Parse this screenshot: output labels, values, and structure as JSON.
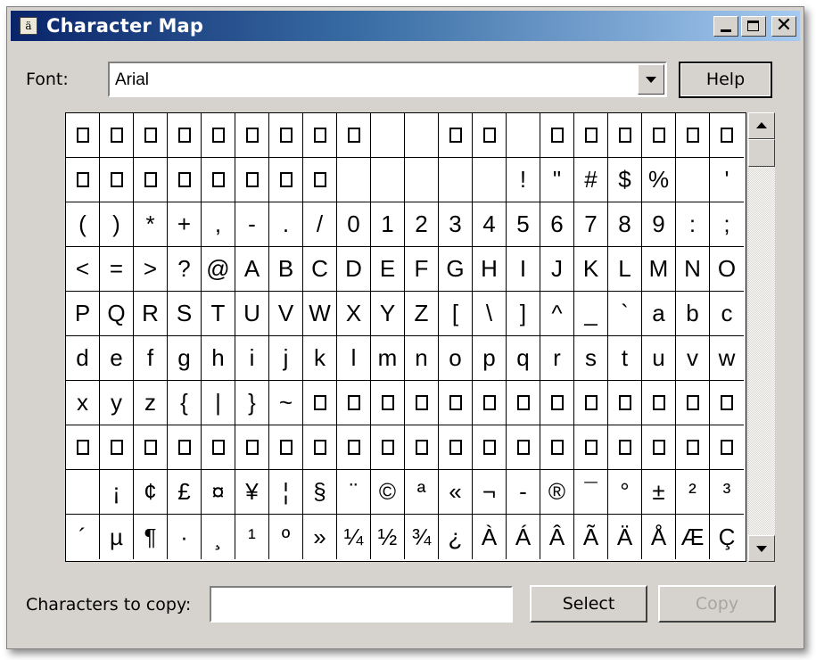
{
  "window": {
    "title": "Character Map",
    "icon": "character-map-app-icon",
    "icon_glyph": "ä"
  },
  "title_buttons": {
    "minimize": "minimize-icon",
    "maximize": "maximize-icon",
    "close": "close-icon",
    "close_glyph": "✕"
  },
  "font_label": "Font:",
  "font_value": "Arial",
  "help_label": "Help",
  "chars_label": "Characters to copy:",
  "chars_value": "",
  "select_label": "Select",
  "copy_label": "Copy",
  "char_grid": [
    [
      "□",
      "□",
      "□",
      "□",
      "□",
      "□",
      "□",
      "□",
      "□",
      "",
      "",
      "□",
      "□",
      "",
      "□",
      "□",
      "□",
      "□",
      "□",
      "□"
    ],
    [
      "□",
      "□",
      "□",
      "□",
      "□",
      "□",
      "□",
      "□",
      "",
      "",
      "",
      "",
      "",
      "!",
      "\"",
      "#",
      "$",
      "%",
      "",
      "'"
    ],
    [
      "(",
      ")",
      "*",
      "+",
      ",",
      "-",
      ".",
      "/",
      "0",
      "1",
      "2",
      "3",
      "4",
      "5",
      "6",
      "7",
      "8",
      "9",
      ":",
      ";"
    ],
    [
      "<",
      "=",
      ">",
      "?",
      "@",
      "A",
      "B",
      "C",
      "D",
      "E",
      "F",
      "G",
      "H",
      "I",
      "J",
      "K",
      "L",
      "M",
      "N",
      "O"
    ],
    [
      "P",
      "Q",
      "R",
      "S",
      "T",
      "U",
      "V",
      "W",
      "X",
      "Y",
      "Z",
      "[",
      "\\",
      "]",
      "^",
      "_",
      "`",
      "a",
      "b",
      "c"
    ],
    [
      "d",
      "e",
      "f",
      "g",
      "h",
      "i",
      "j",
      "k",
      "l",
      "m",
      "n",
      "o",
      "p",
      "q",
      "r",
      "s",
      "t",
      "u",
      "v",
      "w"
    ],
    [
      "x",
      "y",
      "z",
      "{",
      "|",
      "}",
      "~",
      "□",
      "□",
      "□",
      "□",
      "□",
      "□",
      "□",
      "□",
      "□",
      "□",
      "□",
      "□",
      "□"
    ],
    [
      "□",
      "□",
      "□",
      "□",
      "□",
      "□",
      "□",
      "□",
      "□",
      "□",
      "□",
      "□",
      "□",
      "□",
      "□",
      "□",
      "□",
      "□",
      "□",
      "□"
    ],
    [
      "",
      "¡",
      "¢",
      "£",
      "¤",
      "¥",
      "¦",
      "§",
      "¨",
      "©",
      "ª",
      "«",
      "¬",
      "-",
      "®",
      "¯",
      "°",
      "±",
      "²",
      "³"
    ],
    [
      "´",
      "µ",
      "¶",
      "·",
      "¸",
      "¹",
      "º",
      "»",
      "¼",
      "½",
      "¾",
      "¿",
      "À",
      "Á",
      "Â",
      "Ã",
      "Ä",
      "Å",
      "Æ",
      "Ç"
    ]
  ],
  "scrollbar": {
    "up": "scroll-up-arrow-icon",
    "down": "scroll-down-arrow-icon"
  }
}
